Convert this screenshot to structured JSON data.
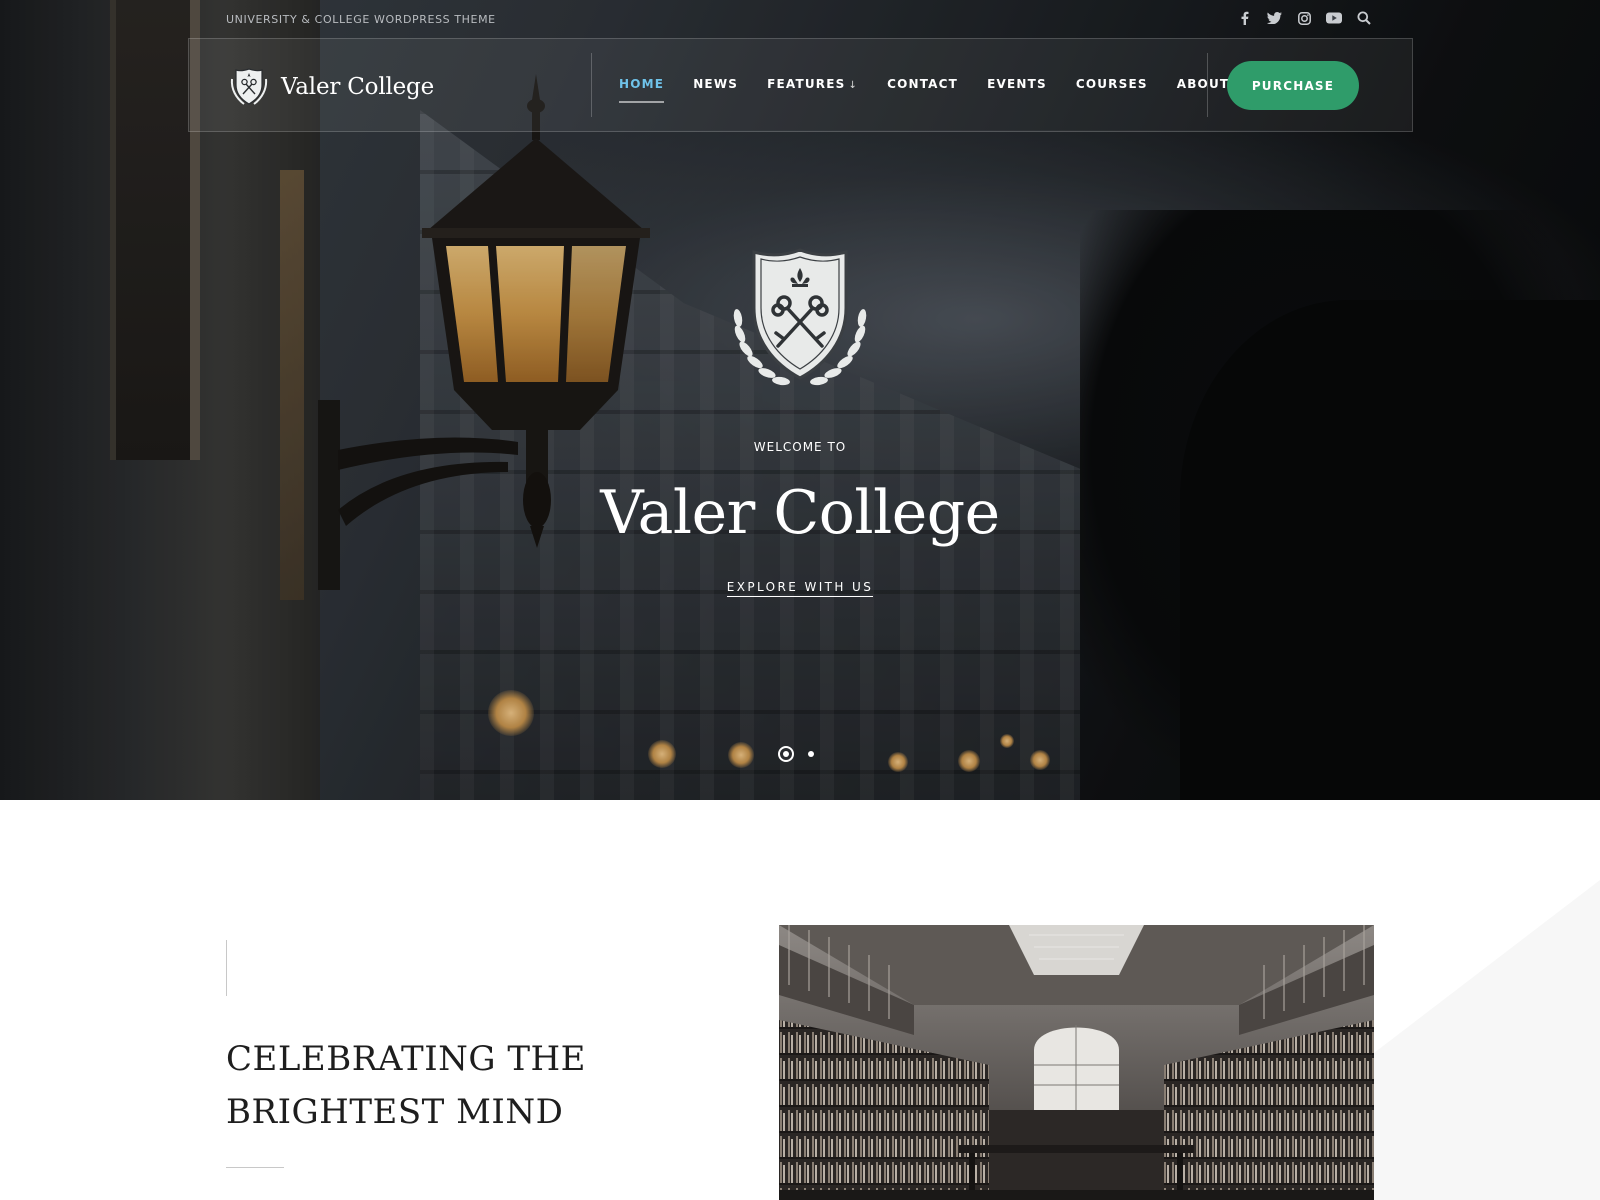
{
  "topbar": {
    "tagline": "UNIVERSITY & COLLEGE WORDPRESS THEME",
    "icons": [
      "facebook-icon",
      "twitter-icon",
      "instagram-icon",
      "youtube-icon",
      "search-icon"
    ]
  },
  "header": {
    "brand": "Valer College",
    "nav": [
      "HOME",
      "NEWS",
      "FEATURES",
      "CONTACT",
      "EVENTS",
      "COURSES",
      "ABOUT"
    ],
    "features_arrow": "↓",
    "purchase_label": "PURCHASE"
  },
  "hero": {
    "welcome": "WELCOME TO",
    "title": "Valer College",
    "cta": "EXPLORE WITH US",
    "slides_total": 2,
    "active_slide": 1
  },
  "section": {
    "heading_line1": "CELEBRATING THE",
    "heading_line2": "BRIGHTEST MIND"
  },
  "colors": {
    "accent_green": "#2f9c6a",
    "active_nav": "#6fc3ea",
    "text_dark": "#1e1e1e"
  }
}
